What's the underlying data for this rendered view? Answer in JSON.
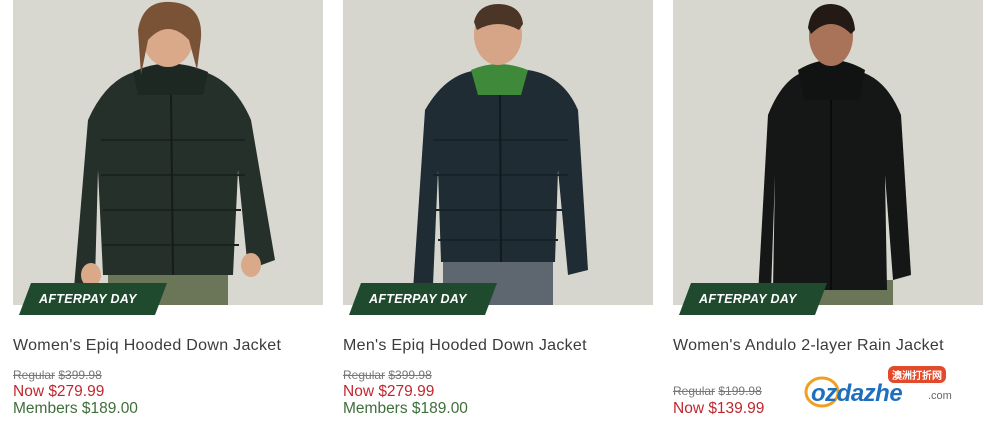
{
  "colors": {
    "badge_bg": "#1f4a2e",
    "now_price": "#c0272d",
    "members_price": "#3e6e3a",
    "title_text": "#3b3b3b"
  },
  "products": [
    {
      "badge": "AFTERPAY DAY",
      "title": "Women's Epiq Hooded Down Jacket",
      "regular_label": "Regular",
      "regular_price": "$399.98",
      "now_price": "Now $279.99",
      "members_price": "Members $189.00",
      "image_desc": "women-down-jacket-photo"
    },
    {
      "badge": "AFTERPAY DAY",
      "title": "Men's Epiq Hooded Down Jacket",
      "regular_label": "Regular",
      "regular_price": "$399.98",
      "now_price": "Now $279.99",
      "members_price": "Members $189.00",
      "image_desc": "men-down-jacket-photo"
    },
    {
      "badge": "AFTERPAY DAY",
      "title": "Women's Andulo 2-layer Rain Jacket",
      "regular_label": "Regular",
      "regular_price": "$199.98",
      "now_price": "Now $139.99",
      "image_desc": "women-rain-jacket-photo"
    }
  ],
  "watermark": {
    "text": "ozdazhe",
    "suffix": ".com",
    "tag": "澳洲打折网"
  }
}
